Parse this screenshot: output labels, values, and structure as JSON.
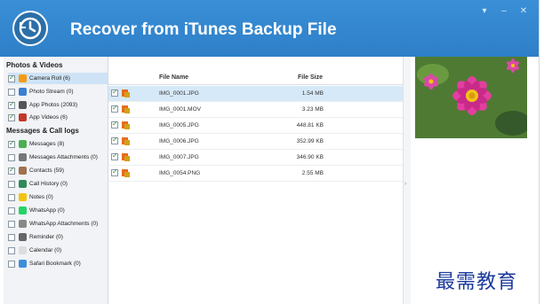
{
  "app": {
    "title": "Recover from iTunes Backup File"
  },
  "window_controls": {
    "dropdown": "▾",
    "minimize": "–",
    "close": "✕"
  },
  "sidebar": {
    "sections": [
      {
        "title": "Photos & Videos"
      },
      {
        "title": "Messages & Call logs"
      }
    ],
    "items": [
      {
        "label": "Camera Roll (6)",
        "checked": true,
        "selected": true,
        "icon": "camera-roll-icon",
        "color": "#f39c12"
      },
      {
        "label": "Photo Stream (0)",
        "checked": false,
        "icon": "photo-stream-icon",
        "color": "#3b7fd4"
      },
      {
        "label": "App Photos (2093)",
        "checked": true,
        "icon": "app-photos-icon",
        "color": "#555555"
      },
      {
        "label": "App Videos (6)",
        "checked": true,
        "icon": "app-videos-icon",
        "color": "#c0392b"
      },
      {
        "label": "Messages (8)",
        "checked": true,
        "icon": "messages-icon",
        "color": "#4caf50"
      },
      {
        "label": "Messages Attachments (0)",
        "checked": false,
        "icon": "messages-attachments-icon",
        "color": "#777777"
      },
      {
        "label": "Contacts (59)",
        "checked": true,
        "icon": "contacts-icon",
        "color": "#a0714f"
      },
      {
        "label": "Call History (0)",
        "checked": false,
        "icon": "call-history-icon",
        "color": "#2e8b57"
      },
      {
        "label": "Notes (0)",
        "checked": false,
        "icon": "notes-icon",
        "color": "#f1c40f"
      },
      {
        "label": "WhatsApp (0)",
        "checked": false,
        "icon": "whatsapp-icon",
        "color": "#25d366"
      },
      {
        "label": "WhatsApp Attachments (0)",
        "checked": false,
        "icon": "whatsapp-attachments-icon",
        "color": "#888888"
      },
      {
        "label": "Reminder (0)",
        "checked": false,
        "icon": "reminder-icon",
        "color": "#666666"
      },
      {
        "label": "Calendar (0)",
        "checked": false,
        "icon": "calendar-icon",
        "color": "#dddddd"
      },
      {
        "label": "Safari Bookmark (0)",
        "checked": false,
        "icon": "safari-bookmark-icon",
        "color": "#3b8fd9"
      }
    ]
  },
  "file_list": {
    "columns": {
      "name": "File Name",
      "size": "File Size"
    },
    "rows": [
      {
        "name": "IMG_0001.JPG",
        "size": "1.54 MB",
        "checked": true,
        "selected": true
      },
      {
        "name": "IMG_0001.MOV",
        "size": "3.23 MB",
        "checked": true
      },
      {
        "name": "IMG_0005.JPG",
        "size": "448.81 KB",
        "checked": true
      },
      {
        "name": "IMG_0006.JPG",
        "size": "352.99 KB",
        "checked": true
      },
      {
        "name": "IMG_0007.JPG",
        "size": "346.90 KB",
        "checked": true
      },
      {
        "name": "IMG_0054.PNG",
        "size": "2.55 MB",
        "checked": true
      }
    ]
  },
  "splitter": {
    "arrow": "›"
  },
  "watermark": {
    "text": "最需教育"
  },
  "colors": {
    "titlebar": "#3a8fd6",
    "selection": "#d6e9f9",
    "check": "#2e8b2e"
  }
}
